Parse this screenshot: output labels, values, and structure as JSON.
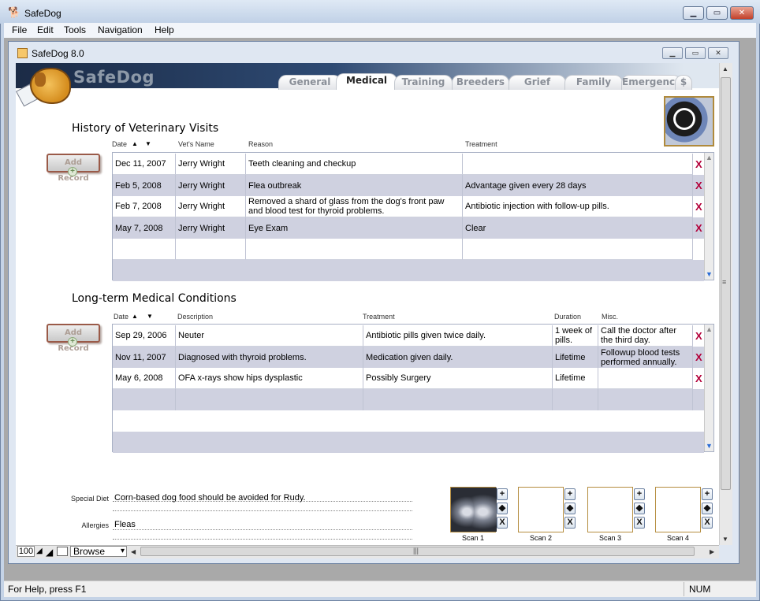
{
  "window": {
    "title": "SafeDog",
    "min": "▁",
    "max": "▭",
    "close": "✕"
  },
  "menu": [
    "File",
    "Edit",
    "Tools",
    "Navigation",
    "Help"
  ],
  "child_window": {
    "title": "SafeDog 8.0"
  },
  "logo": {
    "text": "SafeDog"
  },
  "tabs": [
    {
      "label": "General",
      "active": false
    },
    {
      "label": "Medical",
      "active": true
    },
    {
      "label": "Training",
      "active": false
    },
    {
      "label": "Breeders",
      "active": false
    },
    {
      "label": "Grief",
      "active": false
    },
    {
      "label": "Family",
      "active": false
    },
    {
      "label": "Emergency",
      "active": false
    },
    {
      "label": "$",
      "active": false
    }
  ],
  "visits": {
    "title": "History of Veterinary Visits",
    "add_label": "Add Record",
    "columns": [
      "Date",
      "Vet's Name",
      "Reason",
      "Treatment"
    ],
    "sort_up": "▲",
    "sort_down": "▼",
    "rows": [
      [
        "Dec 11, 2007",
        "Jerry Wright",
        "Teeth cleaning and checkup",
        ""
      ],
      [
        "Feb 5, 2008",
        "Jerry Wright",
        "Flea outbreak",
        "Advantage given every 28 days"
      ],
      [
        "Feb 7, 2008",
        "Jerry Wright",
        "Removed a shard of glass from the dog's front paw and blood test for thyroid problems.",
        "Antibiotic injection with follow-up pills."
      ],
      [
        "May 7, 2008",
        "Jerry Wright",
        "Eye Exam",
        "Clear"
      ],
      [
        "",
        "",
        "",
        ""
      ]
    ],
    "delete_glyph": "X"
  },
  "conditions": {
    "title": "Long-term Medical Conditions",
    "add_label": "Add Record",
    "columns": [
      "Date",
      "Description",
      "Treatment",
      "Duration",
      "Misc."
    ],
    "rows": [
      [
        "Sep 29, 2006",
        "Neuter",
        "Antibiotic pills given twice daily.",
        "1 week of pills.",
        "Call the doctor after the third day."
      ],
      [
        "Nov 11, 2007",
        "Diagnosed with thyroid problems.",
        "Medication given daily.",
        "Lifetime",
        "Followup blood tests performed annually."
      ],
      [
        "May 6, 2008",
        "OFA x-rays show hips dysplastic",
        "Possibly Surgery",
        "Lifetime",
        ""
      ],
      [
        "",
        "",
        "",
        "",
        ""
      ],
      [
        "",
        "",
        "",
        "",
        ""
      ]
    ]
  },
  "form": {
    "special_diet_label": "Special Diet",
    "special_diet_value": "Corn-based dog food should be avoided for Rudy.",
    "allergies_label": "Allergies",
    "allergies_value": "Fleas"
  },
  "scans": [
    {
      "label": "Scan 1",
      "has_image": true
    },
    {
      "label": "Scan 2",
      "has_image": false
    },
    {
      "label": "Scan 3",
      "has_image": false
    },
    {
      "label": "Scan 4",
      "has_image": false
    }
  ],
  "scan_buttons": [
    "+",
    "◆",
    "X"
  ],
  "bottom": {
    "zoom": "100",
    "mode": "Browse",
    "dropdown": "▾"
  },
  "status": {
    "help_text": "For Help, press F1",
    "num": "NUM"
  }
}
